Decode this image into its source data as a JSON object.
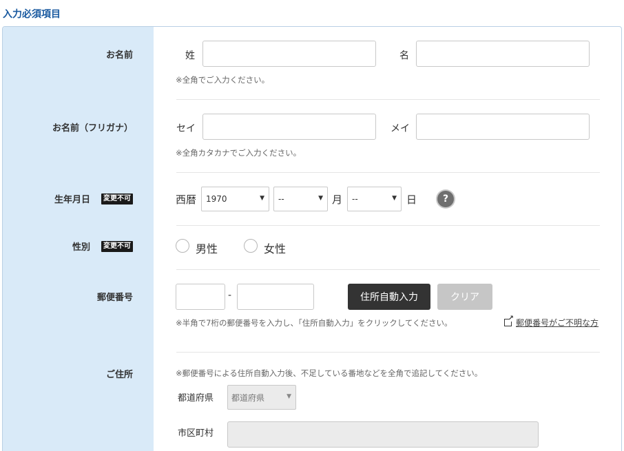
{
  "section_title": "入力必須項目",
  "name": {
    "label": "お名前",
    "last_label": "姓",
    "first_label": "名",
    "last_value": "",
    "first_value": "",
    "note": "※全角でご入力ください。"
  },
  "kana": {
    "label": "お名前（フリガナ）",
    "last_label": "セイ",
    "first_label": "メイ",
    "last_value": "",
    "first_value": "",
    "note": "※全角カタカナでご入力ください。"
  },
  "birth": {
    "label": "生年月日",
    "tag": "変更不可",
    "era": "西暦",
    "year": "1970",
    "month": "--",
    "month_unit": "月",
    "day": "--",
    "day_unit": "日",
    "help": "?"
  },
  "gender": {
    "label": "性別",
    "tag": "変更不可",
    "options": [
      "男性",
      "女性"
    ]
  },
  "postal": {
    "label": "郵便番号",
    "part1": "",
    "part2": "",
    "separator": "-",
    "auto_button": "住所自動入力",
    "clear_button": "クリア",
    "note": "※半角で7桁の郵便番号を入力し、「住所自動入力」をクリックしてください。",
    "link": "郵便番号がご不明な方"
  },
  "address": {
    "label": "ご住所",
    "note": "※郵便番号による住所自動入力後、不足している番地などを全角で追記してください。",
    "pref_label": "都道府県",
    "pref_select": "都道府県",
    "city_label": "市区町村",
    "city_value": ""
  }
}
